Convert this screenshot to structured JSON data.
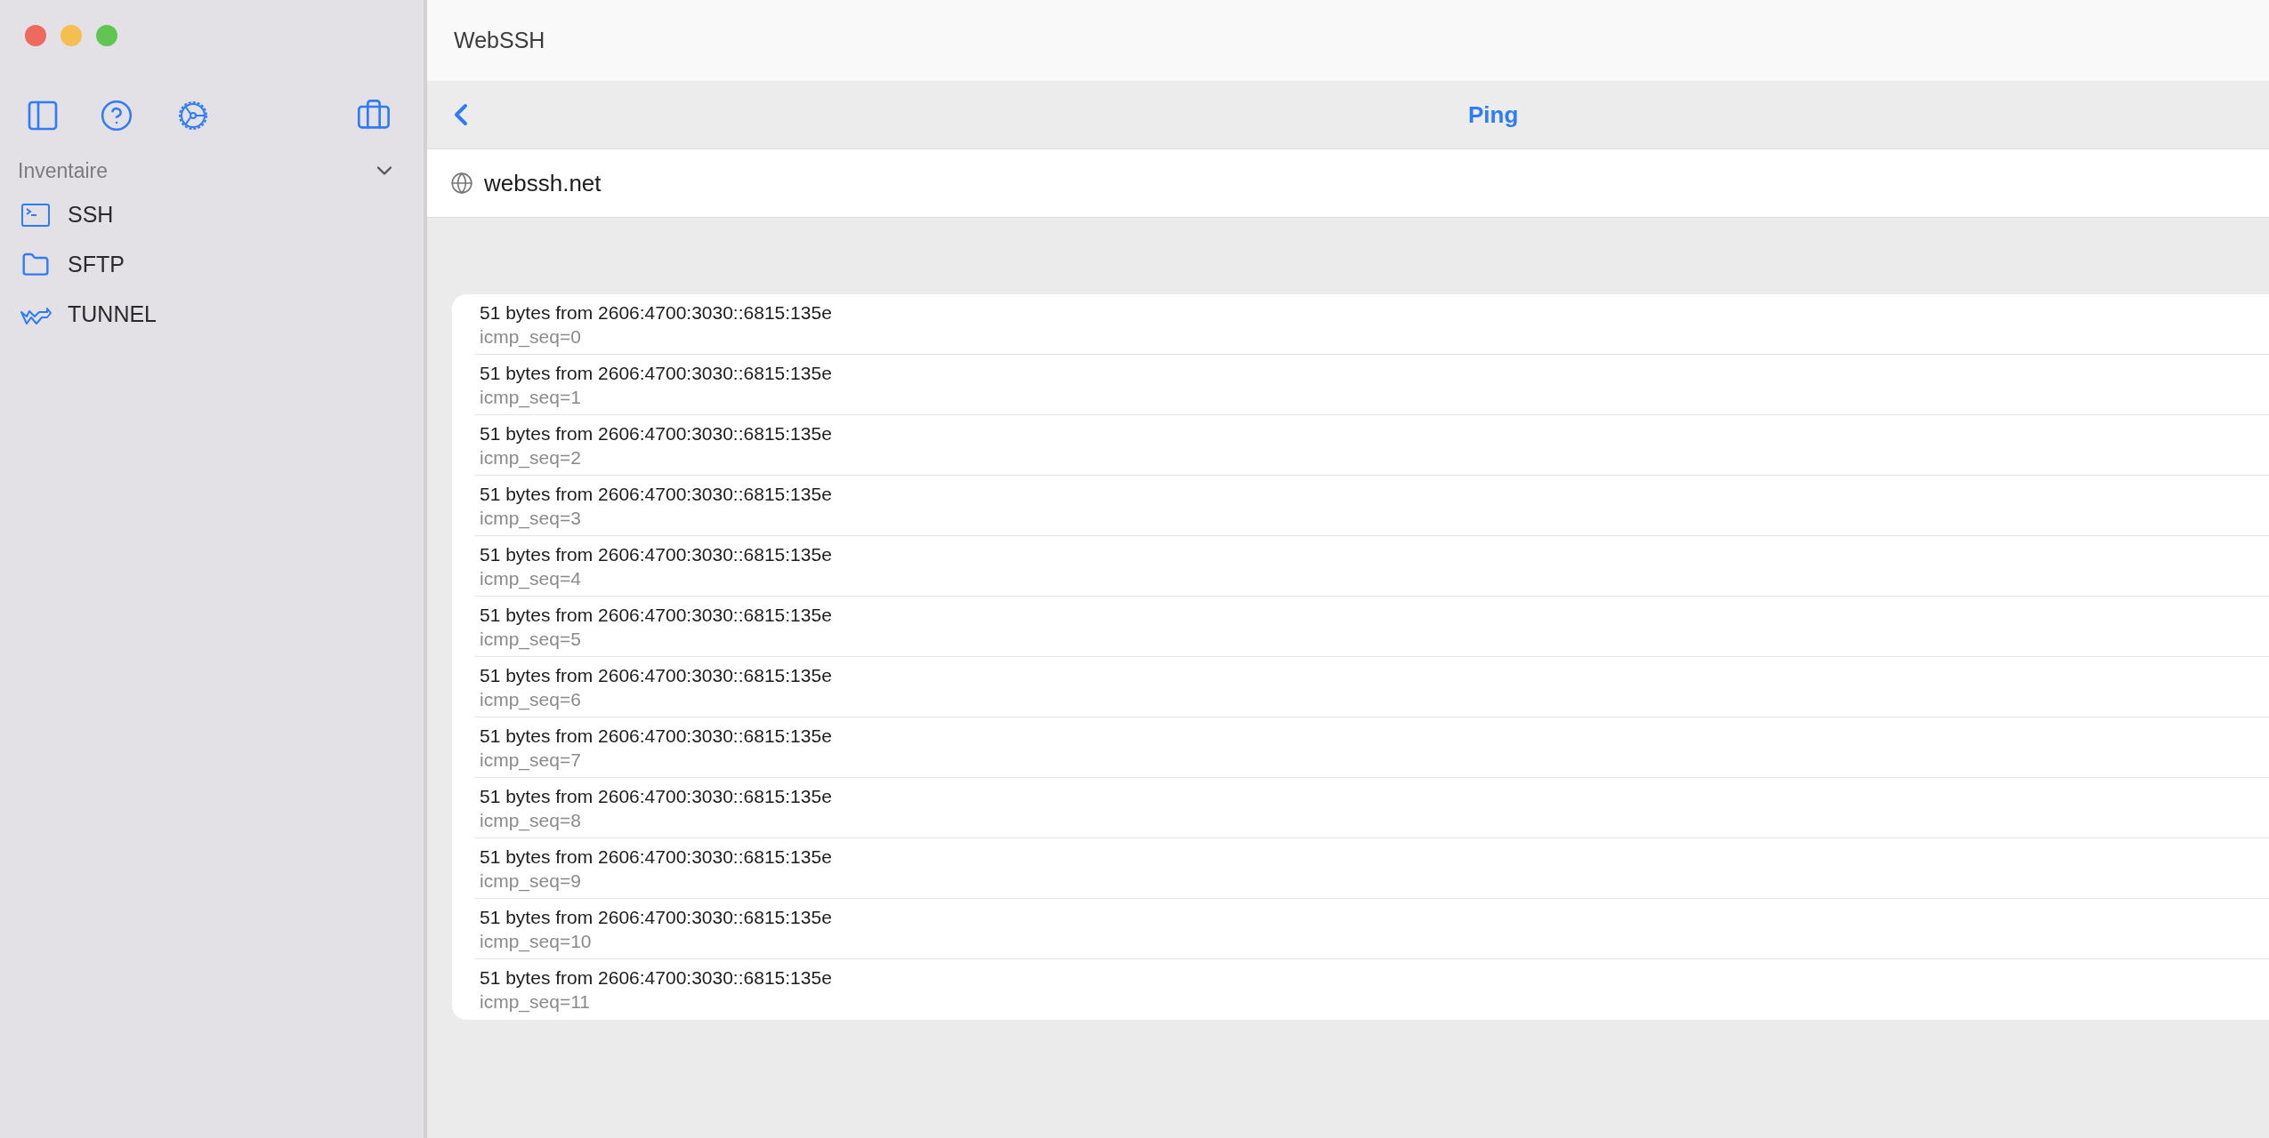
{
  "window": {
    "title": "WebSSH"
  },
  "sidebar": {
    "section": {
      "label": "Inventaire",
      "expanded": true
    },
    "items": [
      {
        "label": "SSH",
        "kind": "terminal"
      },
      {
        "label": "SFTP",
        "kind": "folder"
      },
      {
        "label": "TUNNEL",
        "kind": "tunnel"
      }
    ]
  },
  "nav": {
    "title": "Ping"
  },
  "host": {
    "value": "webssh.net"
  },
  "results": [
    {
      "title": "51 bytes from 2606:4700:3030::6815:135e",
      "subtitle": "icmp_seq=0"
    },
    {
      "title": "51 bytes from 2606:4700:3030::6815:135e",
      "subtitle": "icmp_seq=1"
    },
    {
      "title": "51 bytes from 2606:4700:3030::6815:135e",
      "subtitle": "icmp_seq=2"
    },
    {
      "title": "51 bytes from 2606:4700:3030::6815:135e",
      "subtitle": "icmp_seq=3"
    },
    {
      "title": "51 bytes from 2606:4700:3030::6815:135e",
      "subtitle": "icmp_seq=4"
    },
    {
      "title": "51 bytes from 2606:4700:3030::6815:135e",
      "subtitle": "icmp_seq=5"
    },
    {
      "title": "51 bytes from 2606:4700:3030::6815:135e",
      "subtitle": "icmp_seq=6"
    },
    {
      "title": "51 bytes from 2606:4700:3030::6815:135e",
      "subtitle": "icmp_seq=7"
    },
    {
      "title": "51 bytes from 2606:4700:3030::6815:135e",
      "subtitle": "icmp_seq=8"
    },
    {
      "title": "51 bytes from 2606:4700:3030::6815:135e",
      "subtitle": "icmp_seq=9"
    },
    {
      "title": "51 bytes from 2606:4700:3030::6815:135e",
      "subtitle": "icmp_seq=10"
    },
    {
      "title": "51 bytes from 2606:4700:3030::6815:135e",
      "subtitle": "icmp_seq=11"
    }
  ]
}
